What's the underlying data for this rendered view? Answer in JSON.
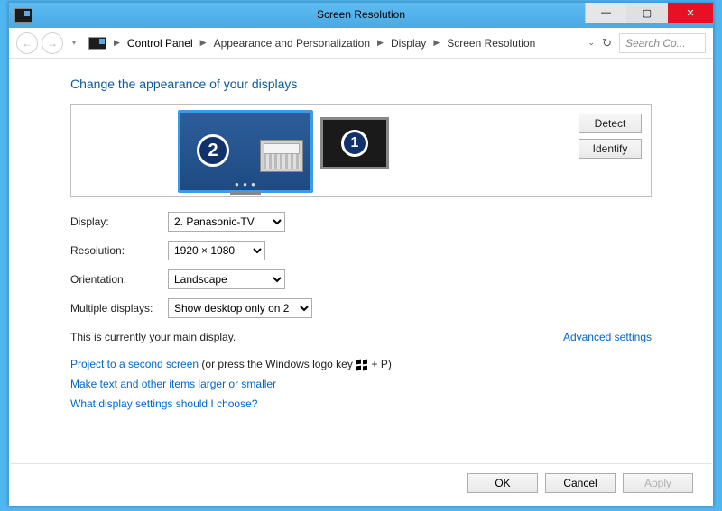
{
  "window": {
    "title": "Screen Resolution"
  },
  "breadcrumbs": {
    "root": "Control Panel",
    "cat": "Appearance and Personalization",
    "sub": "Display",
    "leaf": "Screen Resolution"
  },
  "search": {
    "placeholder": "Search Co..."
  },
  "page": {
    "heading": "Change the appearance of your displays"
  },
  "monitors": {
    "selected_num": "2",
    "other_num": "1"
  },
  "buttons": {
    "detect": "Detect",
    "identify": "Identify",
    "ok": "OK",
    "cancel": "Cancel",
    "apply": "Apply"
  },
  "form": {
    "display_label": "Display:",
    "display_value": "2. Panasonic-TV",
    "resolution_label": "Resolution:",
    "resolution_value": "1920 × 1080",
    "orientation_label": "Orientation:",
    "orientation_value": "Landscape",
    "multiple_label": "Multiple displays:",
    "multiple_value": "Show desktop only on 2"
  },
  "status_text": "This is currently your main display.",
  "advanced_link": "Advanced settings",
  "links": {
    "project": "Project to a second screen",
    "project_suffix_a": " (or press the Windows logo key ",
    "project_suffix_b": " + P)",
    "textsize": "Make text and other items larger or smaller",
    "which": "What display settings should I choose?"
  }
}
